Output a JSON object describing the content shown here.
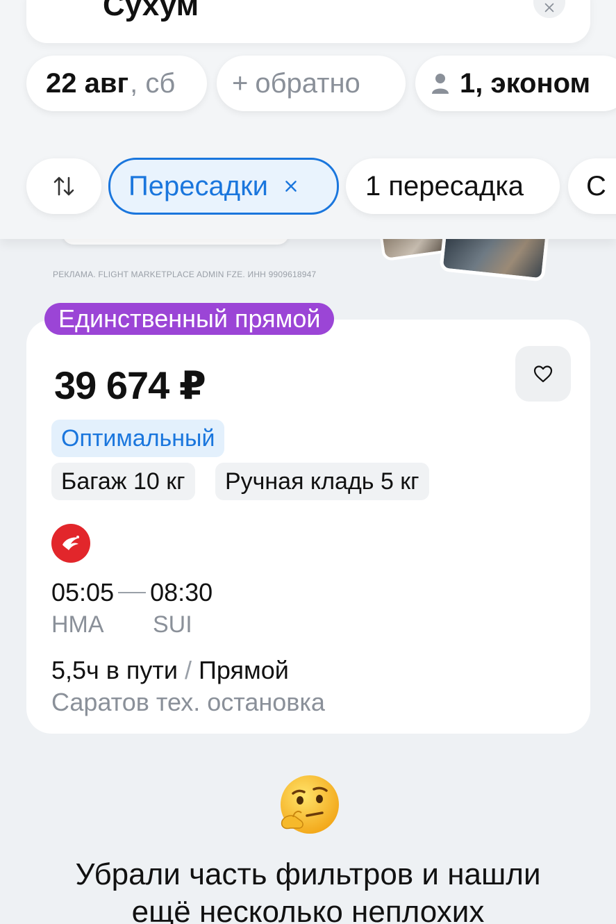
{
  "header": {
    "destination": "Сухум",
    "date_main": "22 авг",
    "date_weekday": ", сб",
    "return_plus": "+",
    "return_label": "обратно",
    "passengers": "1, эконом",
    "filters": {
      "stops_label": "Пересадки",
      "one_stop_label": "1 пересадка",
      "more_label": "С"
    }
  },
  "ad": {
    "disclaimer": "РЕКЛАМА. FLIGHT MARKETPLACE ADMIN FZE. ИНН 9909618947"
  },
  "ticket": {
    "badge": "Единственный прямой",
    "price": "39 674 ₽",
    "fare_tag": "Оптимальный",
    "baggage": "Багаж 10 кг",
    "hand_luggage": "Ручная кладь 5 кг",
    "departure_time": "05:05",
    "arrival_time": "08:30",
    "departure_code": "НМА",
    "arrival_code": "SUI",
    "duration": "5,5ч в пути",
    "duration_sep": " / ",
    "route_type": "Прямой",
    "stop_note": "Саратов тех. остановка"
  },
  "footer": {
    "line1": "Убрали часть фильтров и нашли",
    "line2": "ещё несколько неплохих"
  },
  "colors": {
    "accent": "#1a76dd",
    "badge": "#9b45d6",
    "airline": "#e2262b",
    "background": "#eef1f4"
  },
  "icons": [
    "close-icon",
    "person-icon",
    "sort-icon",
    "heart-icon",
    "airline-logo-icon",
    "thinking-emoji-icon"
  ]
}
